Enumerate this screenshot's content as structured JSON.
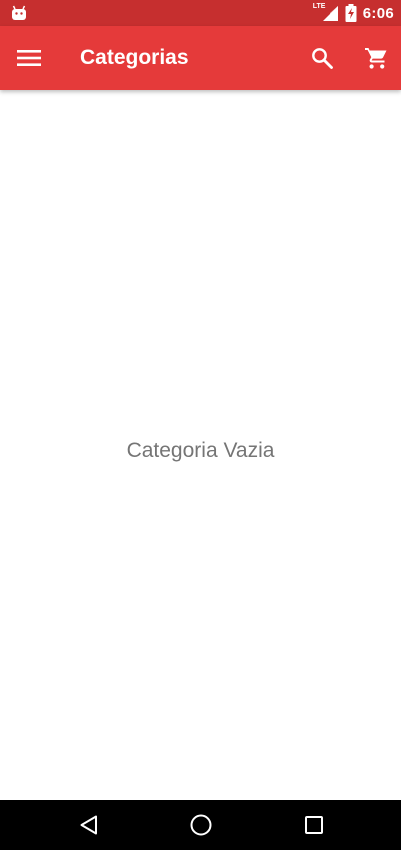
{
  "status_bar": {
    "time": "6:06",
    "network_label": "LTE",
    "notification_icon": "android-icon",
    "signal_icon": "signal-icon",
    "battery_icon": "battery-charging-icon"
  },
  "app_bar": {
    "title": "Categorias",
    "menu_icon": "menu-icon",
    "search_icon": "search-icon",
    "cart_icon": "cart-icon",
    "background_color": "#e53a3a"
  },
  "content": {
    "empty_message": "Categoria Vazia"
  },
  "nav_bar": {
    "back_icon": "back-icon",
    "home_icon": "home-icon",
    "recents_icon": "recents-icon"
  }
}
